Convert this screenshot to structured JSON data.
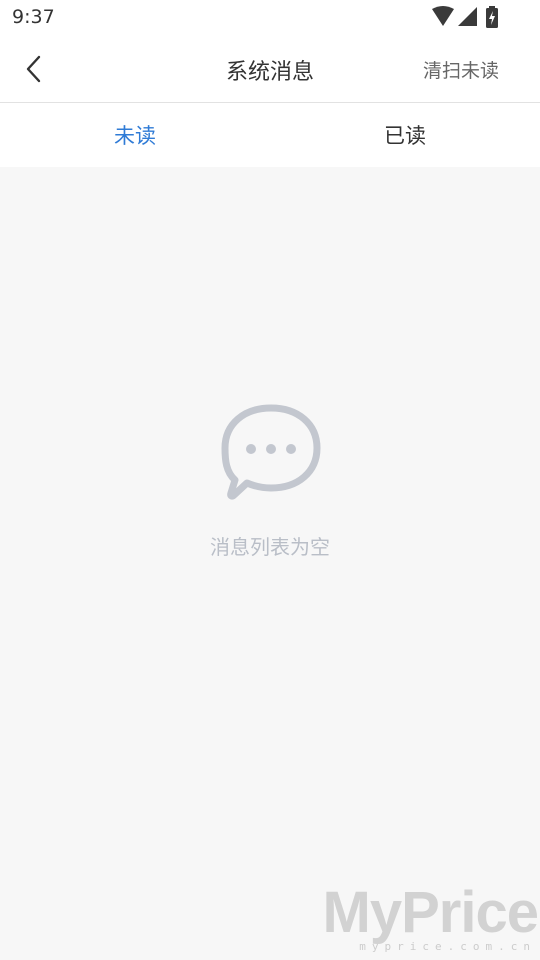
{
  "status_bar": {
    "time": "9:37",
    "icons": [
      "wifi-icon",
      "cellular-signal-icon",
      "battery-charging-icon"
    ]
  },
  "header": {
    "back_icon": "chevron-left-icon",
    "title": "系统消息",
    "clear_unread_label": "清扫未读"
  },
  "tabs": [
    {
      "label": "未读",
      "active": true
    },
    {
      "label": "已读",
      "active": false
    }
  ],
  "empty_state": {
    "icon": "chat-bubble-icon",
    "message": "消息列表为空"
  },
  "watermark": {
    "brand": "MyPrice",
    "domain": "myprice.com.cn"
  },
  "colors": {
    "accent": "#2f7bd6",
    "background": "#f7f7f7",
    "empty_icon": "#c3c7cf",
    "empty_text": "#b9bec7"
  }
}
